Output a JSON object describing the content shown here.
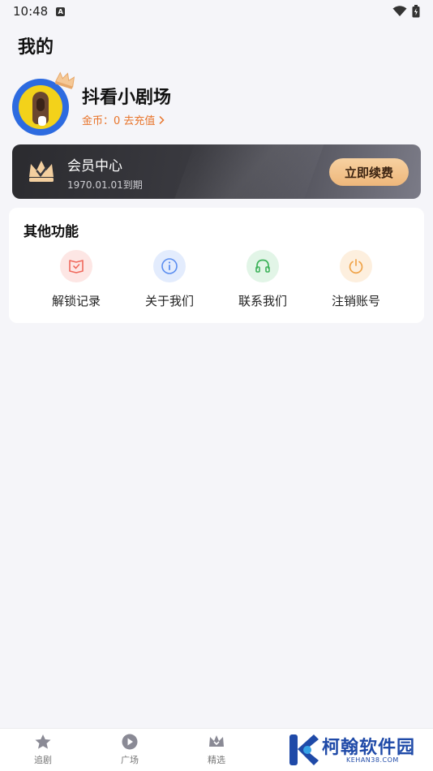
{
  "status_bar": {
    "time": "10:48",
    "notification_icon": "a-icon",
    "signal_icon": "wifi-icon",
    "battery_icon": "battery-icon"
  },
  "page": {
    "title": "我的"
  },
  "profile": {
    "name": "抖看小剧场",
    "coins_text": "金币：0 去充值"
  },
  "vip": {
    "title": "会员中心",
    "expire_text": "1970.01.01到期",
    "renew_label": "立即续费"
  },
  "functions": {
    "title": "其他功能",
    "items": [
      {
        "label": "解锁记录",
        "icon": "unlock-record-icon",
        "color": "#f06a5d",
        "bg": "#fde6e4"
      },
      {
        "label": "关于我们",
        "icon": "info-icon",
        "color": "#5b8ef0",
        "bg": "#e3ecfd"
      },
      {
        "label": "联系我们",
        "icon": "headset-icon",
        "color": "#3db25a",
        "bg": "#e2f5e7"
      },
      {
        "label": "注销账号",
        "icon": "power-icon",
        "color": "#f0a44a",
        "bg": "#fdefde"
      }
    ]
  },
  "tabbar": {
    "tabs": [
      {
        "label": "追剧",
        "icon": "star-icon"
      },
      {
        "label": "广场",
        "icon": "play-icon"
      },
      {
        "label": "精选",
        "icon": "crown-icon"
      }
    ]
  },
  "watermark": {
    "text": "柯翰软件园",
    "sub": "KEHAN38.COM"
  },
  "colors": {
    "accent_orange": "#e8742a",
    "renew_gold": "#eeb77b",
    "vip_dark": "#2b2b2f"
  }
}
